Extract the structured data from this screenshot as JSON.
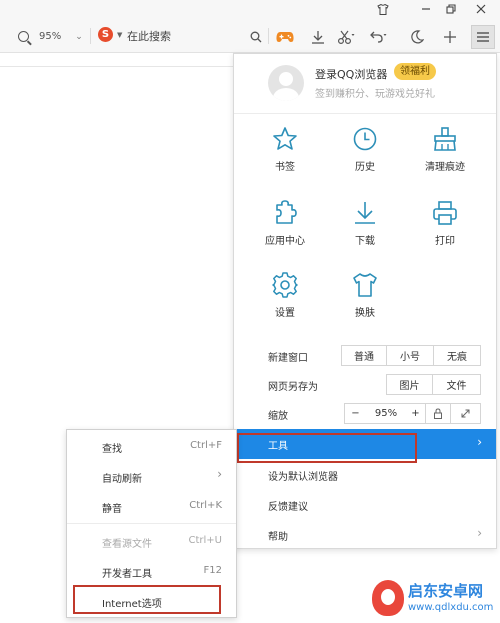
{
  "toolbar": {
    "zoom_level": "95%",
    "search_engine_letter": "S",
    "search_placeholder": "在此搜索"
  },
  "menu": {
    "login_label": "登录QQ浏览器",
    "login_badge": "领福利",
    "login_sub": "签到赚积分、玩游戏兑好礼",
    "grid": [
      {
        "label": "书签",
        "icon": "star-icon"
      },
      {
        "label": "历史",
        "icon": "clock-icon"
      },
      {
        "label": "清理痕迹",
        "icon": "broom-icon"
      },
      {
        "label": "应用中心",
        "icon": "puzzle-icon"
      },
      {
        "label": "下载",
        "icon": "download-icon"
      },
      {
        "label": "打印",
        "icon": "printer-icon"
      },
      {
        "label": "设置",
        "icon": "gear-icon"
      },
      {
        "label": "换肤",
        "icon": "tshirt-icon"
      }
    ],
    "new_window": {
      "label": "新建窗口",
      "options": [
        "普通",
        "小号",
        "无痕"
      ]
    },
    "save_as": {
      "label": "网页另存为",
      "options": [
        "图片",
        "文件"
      ]
    },
    "zoom": {
      "label": "缩放",
      "minus": "−",
      "value": "95%",
      "plus": "+"
    },
    "items": [
      {
        "label": "工具",
        "active": true
      },
      {
        "label": "设为默认浏览器"
      },
      {
        "label": "反馈建议"
      },
      {
        "label": "帮助"
      }
    ]
  },
  "submenu": {
    "items": [
      {
        "label": "查找",
        "shortcut": "Ctrl+F"
      },
      {
        "label": "自动刷新",
        "shortcut": "›"
      },
      {
        "label": "静音",
        "shortcut": "Ctrl+K"
      },
      {
        "label": "查看源文件",
        "shortcut": "Ctrl+U"
      },
      {
        "label": "开发者工具",
        "shortcut": "F12"
      },
      {
        "label": "Internet选项",
        "shortcut": ""
      }
    ]
  },
  "watermark": {
    "name": "启东安卓网",
    "url": "www.qdlxdu.com"
  },
  "colors": {
    "accent": "#1e88e5",
    "icon_teal": "#2c8fb8",
    "highlight_box": "#c0392b",
    "badge": "#f6c94a"
  }
}
